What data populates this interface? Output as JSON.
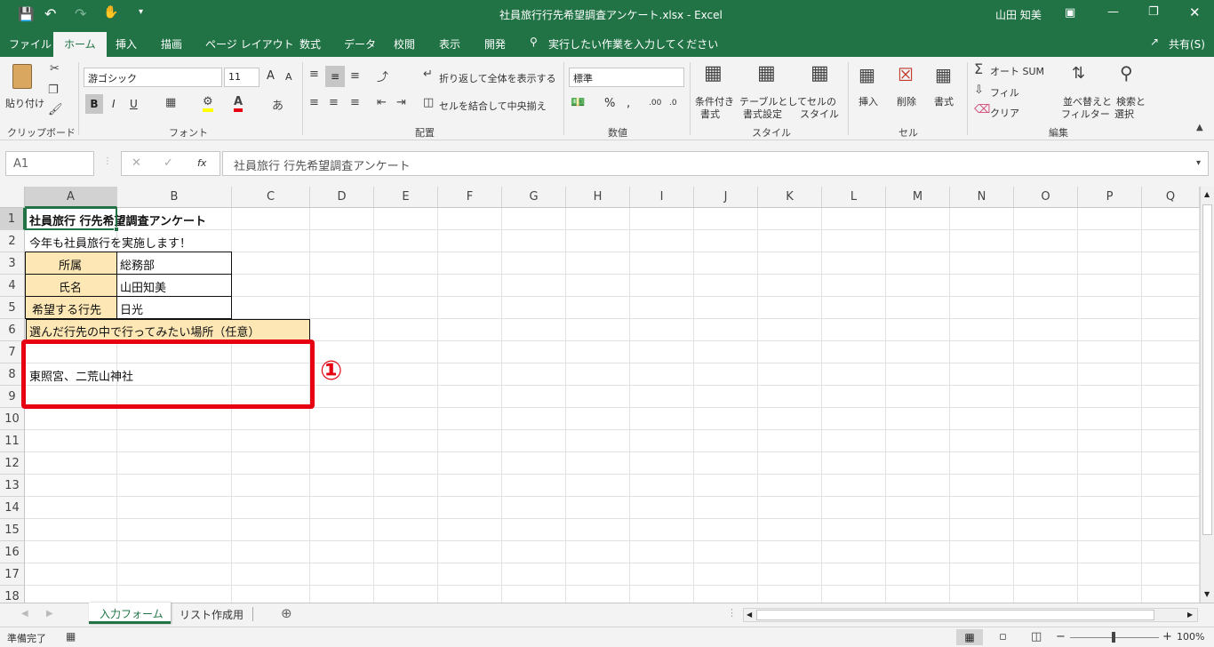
{
  "window": {
    "title": "社員旅行行先希望調査アンケート.xlsx  -  Excel",
    "user": "山田 知美"
  },
  "menu_tabs": [
    "ファイル",
    "ホーム",
    "挿入",
    "描画",
    "ページ レイアウト",
    "数式",
    "データ",
    "校閲",
    "表示",
    "開発"
  ],
  "tell_me": "実行したい作業を入力してください",
  "share": "共有(S)",
  "ribbon": {
    "paste": "貼り付け",
    "clipboard": "クリップボード",
    "font_name": "游ゴシック",
    "font_size": "11",
    "font_group": "フォント",
    "wrap_text": "折り返して全体を表示する",
    "merge_center": "セルを結合して中央揃え",
    "alignment_group": "配置",
    "number_format": "標準",
    "number_group": "数値",
    "conditional_format_1": "条件付き",
    "conditional_format_2": "書式",
    "format_table_1": "テーブルとして",
    "format_table_2": "書式設定",
    "cell_styles_1": "セルの",
    "cell_styles_2": "スタイル",
    "styles_group": "スタイル",
    "insert": "挿入",
    "delete": "削除",
    "format": "書式",
    "cells_group": "セル",
    "autosum": "オート SUM",
    "fill": "フィル",
    "clear": "クリア",
    "sort_filter_1": "並べ替えと",
    "sort_filter_2": "フィルター",
    "find_select_1": "検索と",
    "find_select_2": "選択",
    "editing_group": "編集"
  },
  "formula_bar": {
    "name_box": "A1",
    "fx": "fx",
    "content": "社員旅行 行先希望調査アンケート"
  },
  "columns": [
    "A",
    "B",
    "C",
    "D",
    "E",
    "F",
    "G",
    "H",
    "I",
    "J",
    "K",
    "L",
    "M",
    "N",
    "O",
    "P",
    "Q"
  ],
  "rows": [
    "1",
    "2",
    "3",
    "4",
    "5",
    "6",
    "7",
    "8",
    "9",
    "10",
    "11",
    "12",
    "13",
    "14",
    "15",
    "16",
    "17",
    "18"
  ],
  "cells": {
    "a1": "社員旅行 行先希望調査アンケート",
    "a2": "今年も社員旅行を実施します！",
    "a3": "所属",
    "b3": "総務部",
    "a4": "氏名",
    "b4": "山田知美",
    "a5": "希望する行先",
    "b5": "日光",
    "a6": "選んだ行先の中で行ってみたい場所（任意）",
    "a8": "東照宮、二荒山神社"
  },
  "annotation": "①",
  "sheets": [
    "入力フォーム",
    "リスト作成用"
  ],
  "status": {
    "ready": "準備完了",
    "zoom": "100%"
  },
  "colors": {
    "excel_green": "#217346",
    "label_fill": "#fde7b4",
    "highlight_red": "#e60012"
  }
}
